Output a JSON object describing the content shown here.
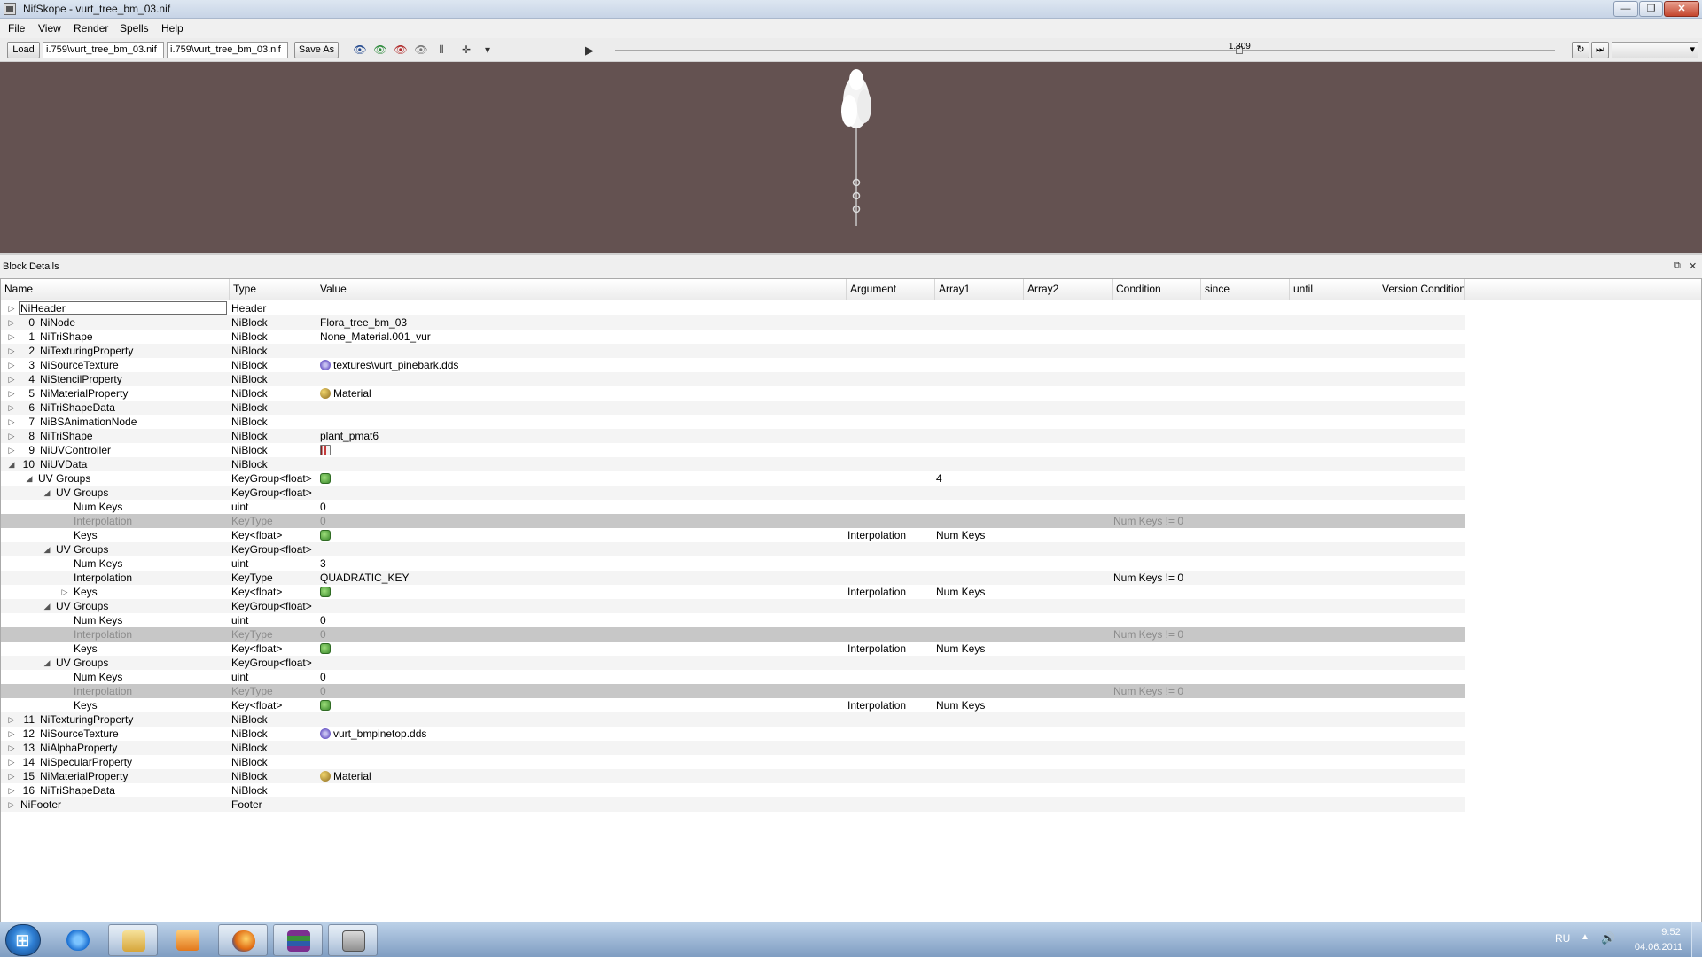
{
  "window": {
    "title": "NifSkope - vurt_tree_bm_03.nif",
    "min_glyph": "—",
    "max_glyph": "❐",
    "close_glyph": "✕"
  },
  "menu": [
    "File",
    "View",
    "Render",
    "Spells",
    "Help"
  ],
  "toolbar": {
    "load_label": "Load",
    "load_path": "i.759\\vurt_tree_bm_03.nif",
    "save_path": "i.759\\vurt_tree_bm_03.nif",
    "save_as_label": "Save As",
    "time_value": "1.309",
    "time_fraction": 0.664
  },
  "dock": {
    "title": "Block Details",
    "float_glyph": "⧉",
    "close_glyph": "✕"
  },
  "columns": [
    "Name",
    "Type",
    "Value",
    "Argument",
    "Array1",
    "Array2",
    "Condition",
    "since",
    "until",
    "Version Condition"
  ],
  "rows": [
    {
      "name": "NiHeader",
      "type": "Header",
      "value": ""
    },
    {
      "num": "0",
      "name": "NiNode",
      "type": "NiBlock",
      "value": "Flora_tree_bm_03"
    },
    {
      "num": "1",
      "name": "NiTriShape",
      "type": "NiBlock",
      "value": "None_Material.001_vur"
    },
    {
      "num": "2",
      "name": "NiTexturingProperty",
      "type": "NiBlock",
      "value": ""
    },
    {
      "num": "3",
      "name": "NiSourceTexture",
      "type": "NiBlock",
      "value": "textures\\vurt_pinebark.dds",
      "icon": "texture-icon"
    },
    {
      "num": "4",
      "name": "NiStencilProperty",
      "type": "NiBlock",
      "value": ""
    },
    {
      "num": "5",
      "name": "NiMaterialProperty",
      "type": "NiBlock",
      "value": "Material",
      "icon": "material-icon"
    },
    {
      "num": "6",
      "name": "NiTriShapeData",
      "type": "NiBlock",
      "value": ""
    },
    {
      "num": "7",
      "name": "NiBSAnimationNode",
      "type": "NiBlock",
      "value": ""
    },
    {
      "num": "8",
      "name": "NiTriShape",
      "type": "NiBlock",
      "value": "plant_pmat6"
    },
    {
      "num": "9",
      "name": "NiUVController",
      "type": "NiBlock",
      "value": "",
      "icon": "controller-flag-icon"
    },
    {
      "num": "10",
      "name": "NiUVData",
      "type": "NiBlock",
      "value": ""
    },
    {
      "name": "UV Groups",
      "type": "KeyGroup<float>",
      "value": "",
      "icon": "array-icon",
      "array1": "4"
    },
    {
      "name": "UV Groups",
      "type": "KeyGroup<float>",
      "value": ""
    },
    {
      "name": "Num Keys",
      "type": "uint",
      "value": "0"
    },
    {
      "name": "Interpolation",
      "type": "KeyType",
      "value": "0",
      "condition": "Num Keys != 0"
    },
    {
      "name": "Keys",
      "type": "Key<float>",
      "value": "",
      "icon": "array-icon",
      "argument": "Interpolation",
      "array1": "Num Keys"
    },
    {
      "name": "UV Groups",
      "type": "KeyGroup<float>",
      "value": ""
    },
    {
      "name": "Num Keys",
      "type": "uint",
      "value": "3"
    },
    {
      "name": "Interpolation",
      "type": "KeyType",
      "value": "QUADRATIC_KEY",
      "condition": "Num Keys != 0"
    },
    {
      "name": "Keys",
      "type": "Key<float>",
      "value": "",
      "icon": "array-icon",
      "argument": "Interpolation",
      "array1": "Num Keys"
    },
    {
      "name": "UV Groups",
      "type": "KeyGroup<float>",
      "value": ""
    },
    {
      "name": "Num Keys",
      "type": "uint",
      "value": "0"
    },
    {
      "name": "Interpolation",
      "type": "KeyType",
      "value": "0",
      "condition": "Num Keys != 0"
    },
    {
      "name": "Keys",
      "type": "Key<float>",
      "value": "",
      "icon": "array-icon",
      "argument": "Interpolation",
      "array1": "Num Keys"
    },
    {
      "name": "UV Groups",
      "type": "KeyGroup<float>",
      "value": ""
    },
    {
      "name": "Num Keys",
      "type": "uint",
      "value": "0"
    },
    {
      "name": "Interpolation",
      "type": "KeyType",
      "value": "0",
      "condition": "Num Keys != 0"
    },
    {
      "name": "Keys",
      "type": "Key<float>",
      "value": "",
      "icon": "array-icon",
      "argument": "Interpolation",
      "array1": "Num Keys"
    },
    {
      "num": "11",
      "name": "NiTexturingProperty",
      "type": "NiBlock",
      "value": ""
    },
    {
      "num": "12",
      "name": "NiSourceTexture",
      "type": "NiBlock",
      "value": "vurt_bmpinetop.dds",
      "icon": "texture-icon"
    },
    {
      "num": "13",
      "name": "NiAlphaProperty",
      "type": "NiBlock",
      "value": ""
    },
    {
      "num": "14",
      "name": "NiSpecularProperty",
      "type": "NiBlock",
      "value": ""
    },
    {
      "num": "15",
      "name": "NiMaterialProperty",
      "type": "NiBlock",
      "value": "Material",
      "icon": "material-icon"
    },
    {
      "num": "16",
      "name": "NiTriShapeData",
      "type": "NiBlock",
      "value": ""
    },
    {
      "name": "NiFooter",
      "type": "Footer",
      "value": ""
    }
  ],
  "taskbar": {
    "apps": [
      "start-button",
      "internet-explorer-icon",
      "explorer-folder-icon",
      "media-player-icon",
      "firefox-icon",
      "winrar-icon",
      "nifskope-icon"
    ],
    "language": "RU",
    "time": "9:52",
    "date": "04.06.2011"
  },
  "colors": {
    "viewport_bg": "#645251",
    "disabled_row": "#c7c7c7"
  }
}
